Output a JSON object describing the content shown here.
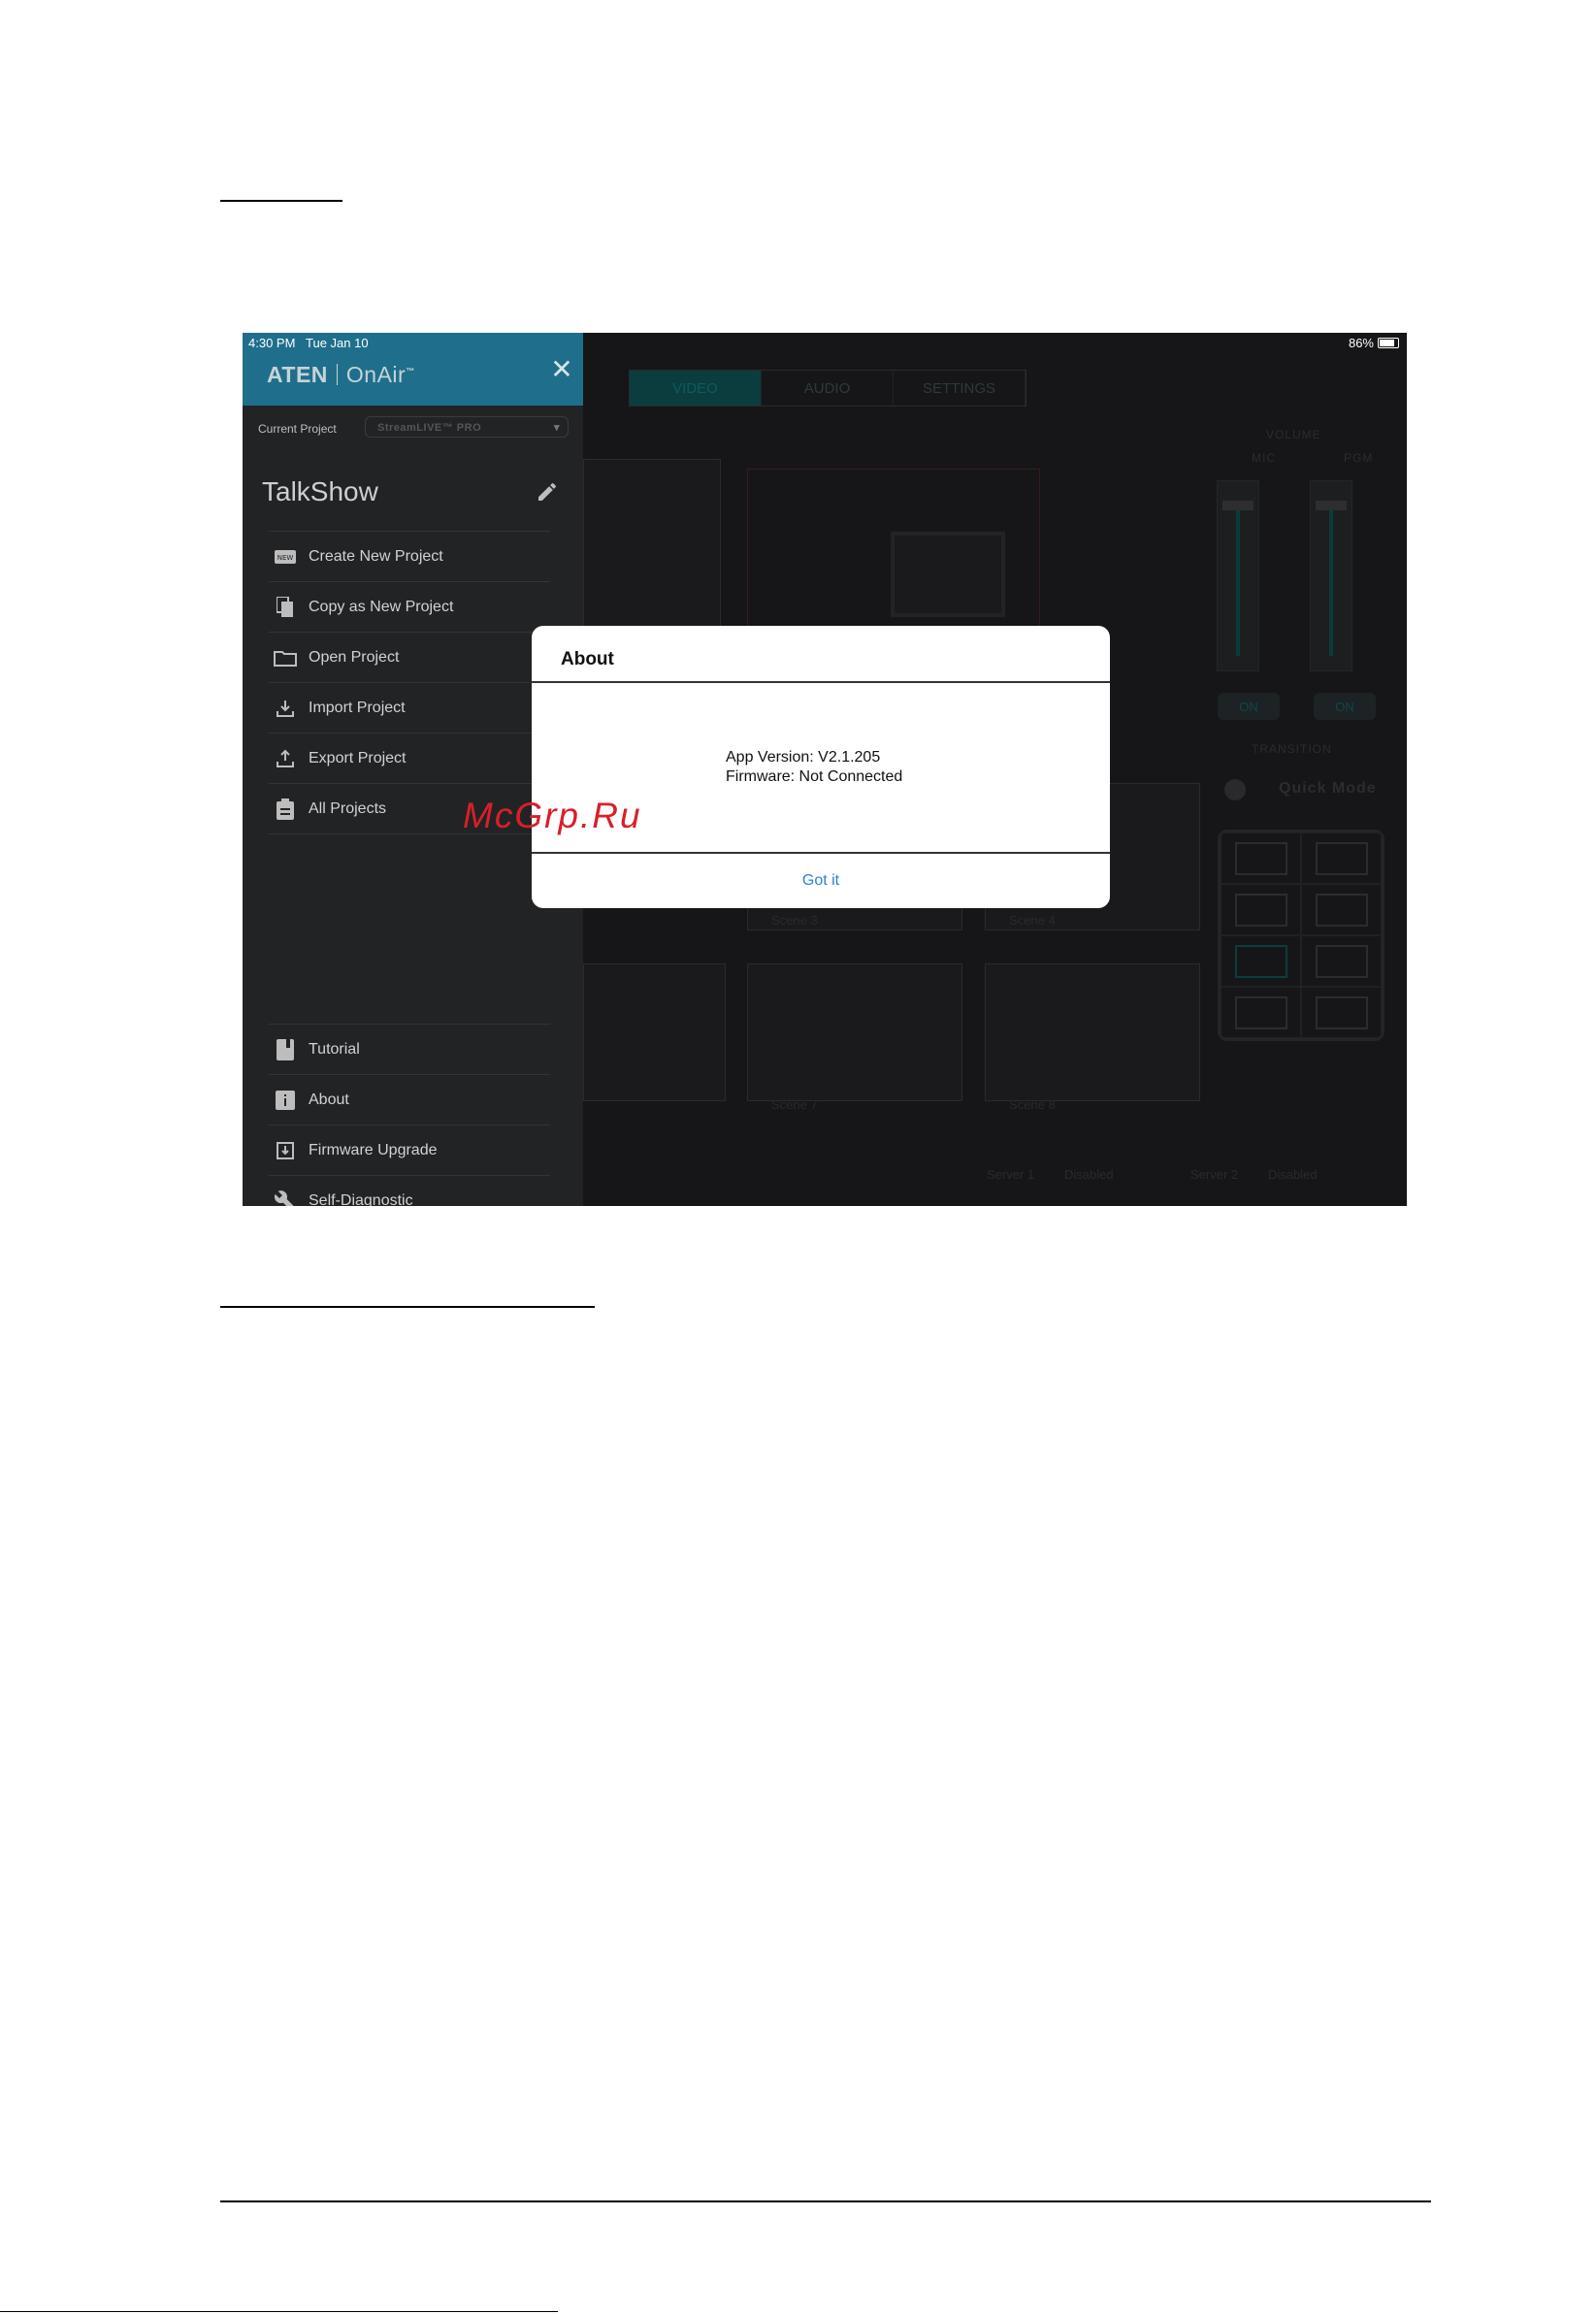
{
  "status_bar": {
    "time": "4:30 PM",
    "date": "Tue Jan 10",
    "battery": "86%"
  },
  "sidebar": {
    "brand": "ATEN",
    "product": "OnAir",
    "tm": "™",
    "current_project_label": "Current Project",
    "current_project_value": "StreamLIVE™ PRO",
    "project_name": "TalkShow",
    "menu_top": [
      {
        "label": "Create New Project",
        "icon": "new-badge-icon"
      },
      {
        "label": "Copy as New Project",
        "icon": "copy-icon"
      },
      {
        "label": "Open Project",
        "icon": "folder-icon"
      },
      {
        "label": "Import Project",
        "icon": "import-icon"
      },
      {
        "label": "Export Project",
        "icon": "export-icon"
      },
      {
        "label": "All Projects",
        "icon": "clipboard-icon"
      }
    ],
    "menu_bottom": [
      {
        "label": "Tutorial",
        "icon": "book-icon"
      },
      {
        "label": "About",
        "icon": "info-icon"
      },
      {
        "label": "Firmware Upgrade",
        "icon": "firmware-icon"
      },
      {
        "label": "Self-Diagnostic",
        "icon": "wrench-icon"
      }
    ]
  },
  "background": {
    "tabs": [
      "VIDEO",
      "AUDIO",
      "SETTINGS"
    ],
    "volume_title": "VOLUME",
    "mic_label": "MIC",
    "pgm_label": "PGM",
    "on_label": "ON",
    "transition_title": "TRANSITION",
    "quick_mode": "Quick Mode",
    "scenes": [
      "Scene 3",
      "Scene 4",
      "Scene 7",
      "Scene 8"
    ],
    "server1": "Server 1",
    "server2": "Server 2",
    "disabled": "Disabled"
  },
  "dialog": {
    "title": "About",
    "app_version": "App Version: V2.1.205",
    "firmware": "Firmware: Not Connected",
    "ok_label": "Got it"
  },
  "watermark": "McGrp.Ru"
}
